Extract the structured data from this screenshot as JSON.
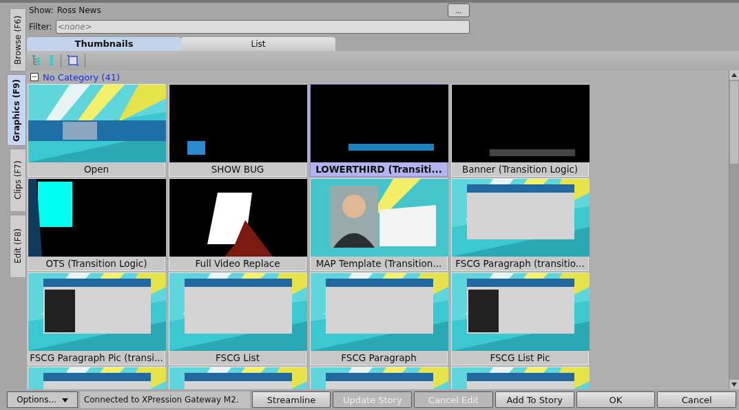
{
  "side_tabs": [
    {
      "label": "Browse (F6)",
      "selected": false
    },
    {
      "label": "Graphics (F9)",
      "selected": true
    },
    {
      "label": "Clips (F7)",
      "selected": false
    },
    {
      "label": "Edit (F8)",
      "selected": false
    }
  ],
  "show": {
    "label": "Show:",
    "value": "Ross News",
    "browse_button": "..."
  },
  "filter": {
    "label": "Filter:",
    "placeholder": "<none>"
  },
  "view_tabs": [
    {
      "label": "Thumbnails",
      "selected": true
    },
    {
      "label": "List",
      "selected": false
    }
  ],
  "category": {
    "expander": "−",
    "label": "No Category (41)"
  },
  "tiles": [
    {
      "label": "Open",
      "selected": false,
      "kind": "picture"
    },
    {
      "label": "SHOW BUG",
      "selected": false,
      "kind": "picture"
    },
    {
      "label": "LOWERTHIRD (Transiti...",
      "selected": true,
      "kind": "picture"
    },
    {
      "label": "Banner (Transition Logic)",
      "selected": false,
      "kind": "picture"
    },
    {
      "label": "OTS (Transition Logic)",
      "selected": false,
      "kind": "picture"
    },
    {
      "label": "Full Video Replace",
      "selected": false,
      "kind": "picture"
    },
    {
      "label": "MAP Template (Transition...",
      "selected": false,
      "kind": "picture"
    },
    {
      "label": "FSCG Paragraph (transitio...",
      "selected": false,
      "kind": "picture"
    },
    {
      "label": "FSCG Paragraph Pic (transi...",
      "selected": false,
      "kind": "picture"
    },
    {
      "label": "FSCG List",
      "selected": false,
      "kind": "picture"
    },
    {
      "label": "FSCG Paragraph",
      "selected": false,
      "kind": "picture"
    },
    {
      "label": "FSCG List Pic",
      "selected": false,
      "kind": "picture"
    },
    {
      "kind": "picture"
    },
    {
      "kind": "picture"
    },
    {
      "kind": "picture"
    },
    {
      "kind": "picture"
    }
  ],
  "footer": {
    "options": "Options...",
    "status": "Connected to XPression Gateway M2.",
    "buttons": [
      {
        "label": "Streamline",
        "disabled": false
      },
      {
        "label": "Update Story",
        "disabled": true
      },
      {
        "label": "Cancel Edit",
        "disabled": true
      },
      {
        "label": "Add To Story",
        "disabled": false
      },
      {
        "label": "OK",
        "disabled": false
      },
      {
        "label": "Cancel",
        "disabled": false
      }
    ]
  }
}
